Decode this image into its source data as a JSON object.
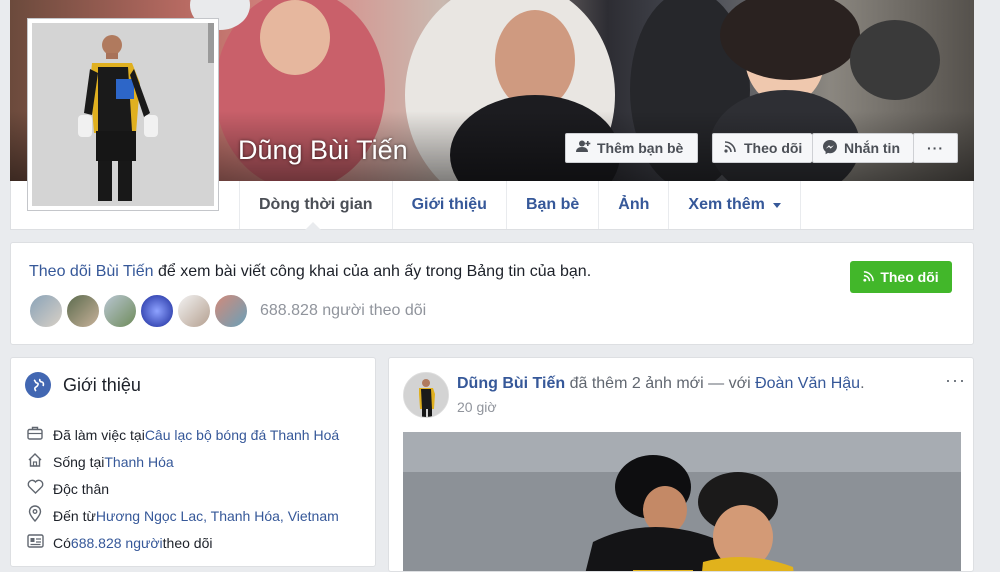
{
  "profile": {
    "name": "Dũng Bùi Tiến"
  },
  "cover_actions": [
    {
      "label": "Thêm bạn bè",
      "icon": "add-friend-icon"
    },
    {
      "label": "Theo dõi",
      "icon": "rss-icon"
    },
    {
      "label": "Nhắn tin",
      "icon": "messenger-icon"
    },
    {
      "label": "···",
      "icon": "more-icon"
    }
  ],
  "nav": {
    "tabs": [
      {
        "label": "Dòng thời gian",
        "active": true
      },
      {
        "label": "Giới thiệu"
      },
      {
        "label": "Bạn bè"
      },
      {
        "label": "Ảnh"
      },
      {
        "label": "Xem thêm",
        "dropdown": true
      }
    ]
  },
  "follow": {
    "link_text": "Theo dõi Bùi Tiến",
    "rest_text": " để xem bài viết công khai của anh ấy trong Bảng tin của bạn.",
    "button_label": "Theo dõi",
    "follower_count": "688.828 người theo dõi",
    "button_color": "#42b72a"
  },
  "intro": {
    "title": "Giới thiệu",
    "rows": [
      {
        "icon": "briefcase-icon",
        "prefix": "Đã làm việc tại ",
        "link": "Câu lạc bộ bóng đá Thanh Hoá",
        "suffix": ""
      },
      {
        "icon": "home-icon",
        "prefix": "Sống tại ",
        "link": "Thanh Hóa",
        "suffix": ""
      },
      {
        "icon": "heart-icon",
        "prefix": "Độc thân",
        "link": "",
        "suffix": ""
      },
      {
        "icon": "location-pin-icon",
        "prefix": "Đến từ ",
        "link": "Hương Ngọc Lac, Thanh Hóa, Vietnam",
        "suffix": ""
      },
      {
        "icon": "followers-icon",
        "prefix": "Có ",
        "link": "688.828 người",
        "suffix": " theo dõi"
      }
    ]
  },
  "post": {
    "author": "Dũng Bùi Tiến",
    "action": " đã thêm 2 ảnh mới — với ",
    "tagged": "Đoàn Văn Hậu",
    "end": ".",
    "time": "20 giờ",
    "more": "···"
  },
  "colors": {
    "link": "#365899",
    "background": "#e9ebee"
  }
}
